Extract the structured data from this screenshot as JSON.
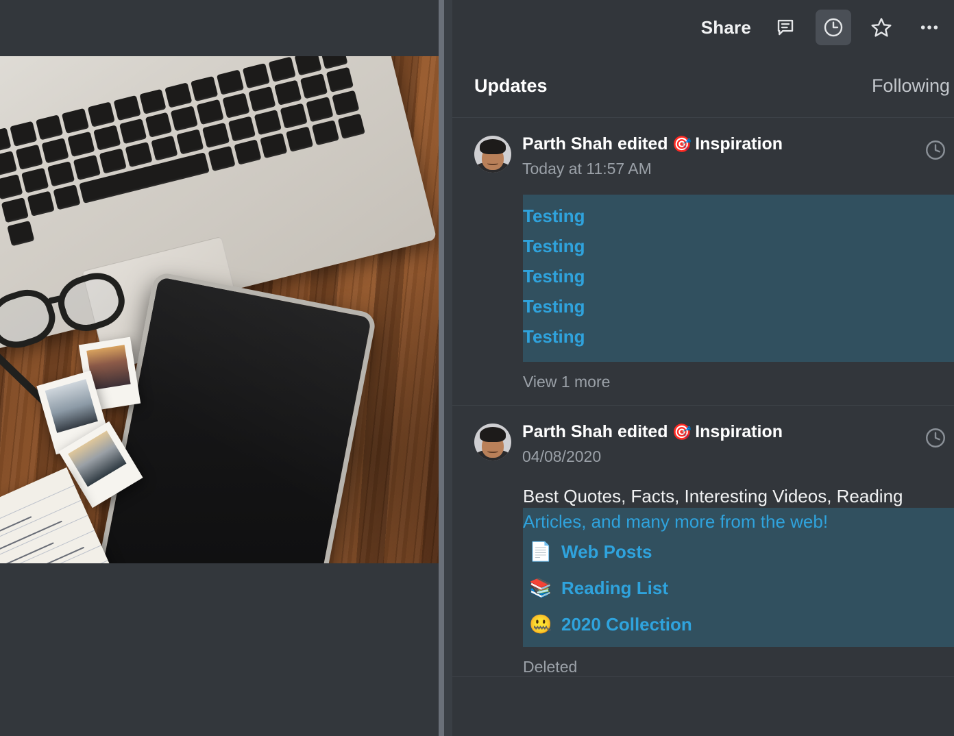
{
  "toolbar": {
    "share_label": "Share",
    "icons": [
      {
        "name": "comment-icon",
        "active": false
      },
      {
        "name": "history-clock-icon",
        "active": true
      },
      {
        "name": "star-icon",
        "active": false
      },
      {
        "name": "more-options-icon",
        "active": false
      }
    ]
  },
  "panel": {
    "title": "Updates",
    "filter_label": "Following"
  },
  "colors": {
    "background": "#32363b",
    "highlight": "#31505f",
    "link_blue": "#2fa3dd",
    "muted_text": "#9ba1a8",
    "active_button": "#4a4f56"
  },
  "updates": [
    {
      "author": "Parth Shah",
      "action": "edited",
      "target_emoji": "🎯",
      "target": "Inspiration",
      "timestamp": "Today at 11:57 AM",
      "changes": [
        "Testing",
        "Testing",
        "Testing",
        "Testing",
        "Testing"
      ],
      "footer_label": "View 1 more",
      "clock_icon": "clock-icon"
    },
    {
      "author": "Parth Shah",
      "action": "edited",
      "target_emoji": "🎯",
      "target": "Inspiration",
      "timestamp": "04/08/2020",
      "body_line_plain": "Best Quotes, Facts, Interesting Videos, Reading",
      "body_line_link": "Articles, and many more from the web!",
      "items": [
        {
          "emoji": "📄",
          "label": "Web Posts",
          "icon_name": "page-facing-up-emoji"
        },
        {
          "emoji": "📚",
          "label": "Reading List",
          "icon_name": "books-emoji"
        },
        {
          "emoji": "🤐",
          "label": "2020 Collection",
          "icon_name": "zipper-mouth-face-emoji"
        }
      ],
      "footer_label": "Deleted",
      "clock_icon": "clock-icon"
    }
  ],
  "preview": {
    "alt": "Photo of a laptop, tablet, glasses, polaroid photos and a notebook on a wooden desk"
  }
}
